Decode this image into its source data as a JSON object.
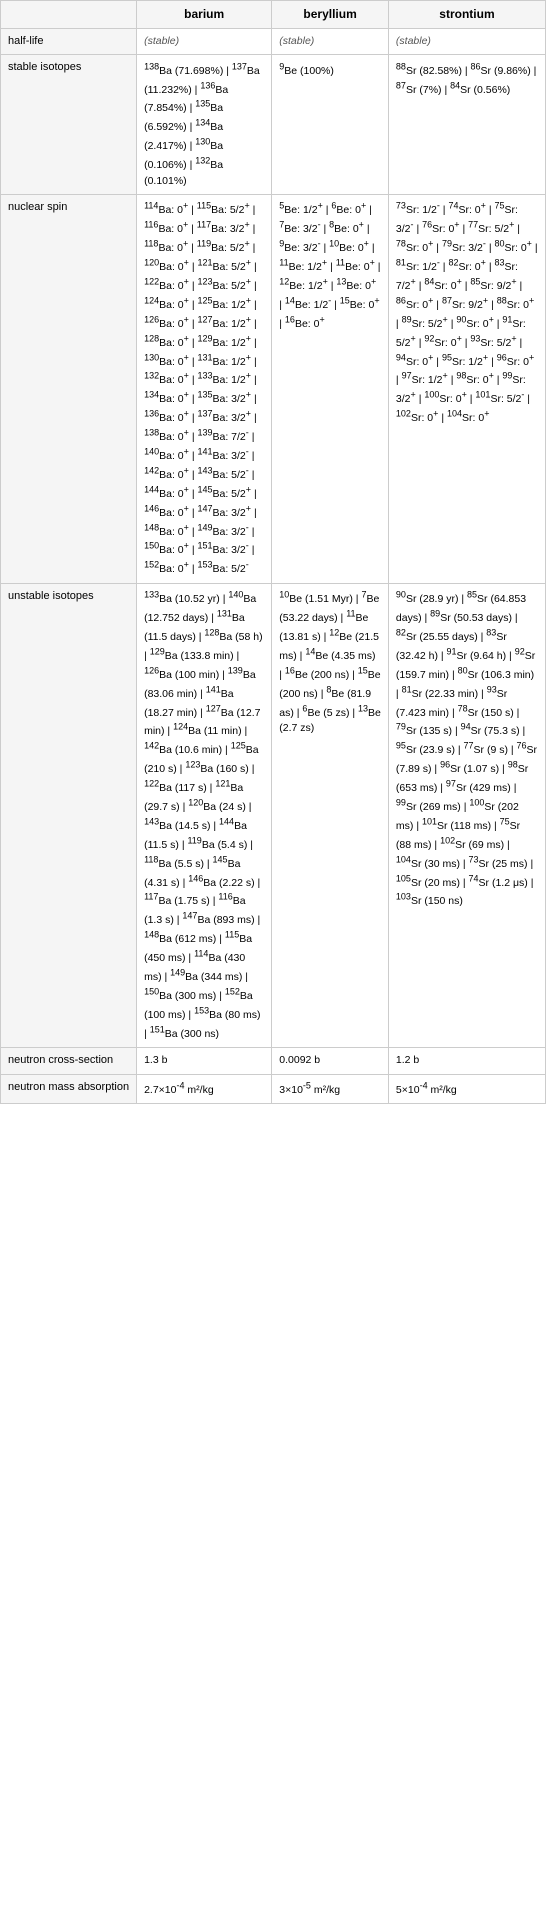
{
  "columns": {
    "element": "",
    "barium": "barium",
    "beryllium": "beryllium",
    "strontium": "strontium"
  },
  "rows": {
    "half_life": {
      "label": "half-life",
      "barium": "(stable)",
      "beryllium": "(stable)",
      "strontium": "(stable)"
    },
    "stable_isotopes": {
      "label": "stable isotopes"
    },
    "nuclear_spin": {
      "label": "nuclear spin"
    },
    "unstable_isotopes": {
      "label": "unstable isotopes"
    },
    "neutron_cross_section": {
      "label": "neutron cross-section",
      "barium": "1.3 b",
      "beryllium": "0.0092 b",
      "strontium": "1.2 b"
    },
    "neutron_mass_absorption": {
      "label": "neutron mass absorption",
      "barium": "2.7×10⁻⁴ m²/kg",
      "beryllium": "3×10⁻⁵ m²/kg",
      "strontium": "5×10⁻⁴ m²/kg"
    }
  }
}
